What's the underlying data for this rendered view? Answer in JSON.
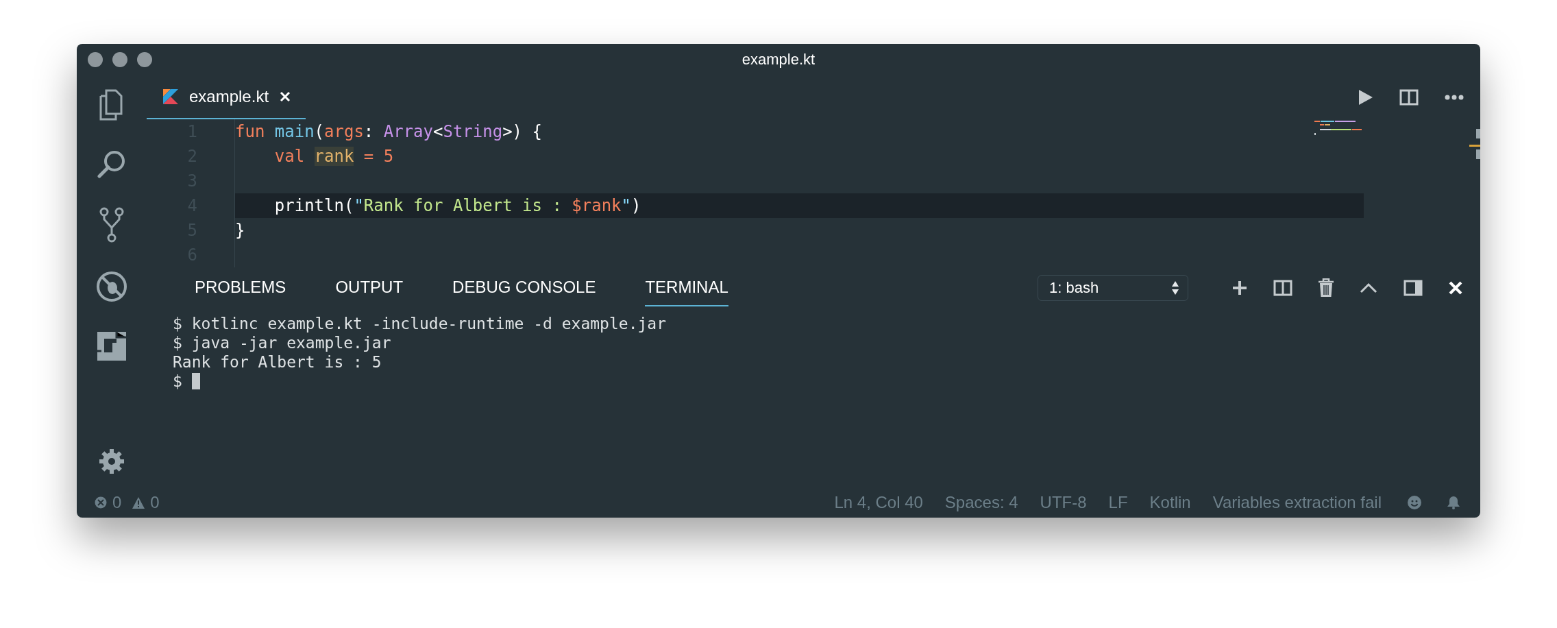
{
  "window": {
    "title": "example.kt"
  },
  "editor_tabs": [
    {
      "label": "example.kt",
      "selected": true
    }
  ],
  "code": {
    "lines": [
      {
        "number": "1",
        "current": false,
        "tokens": [
          {
            "text": "fun ",
            "kind": "keyword"
          },
          {
            "text": "main",
            "kind": "function"
          },
          {
            "text": "(",
            "kind": "plain"
          },
          {
            "text": "args",
            "kind": "keyword"
          },
          {
            "text": ": ",
            "kind": "param"
          },
          {
            "text": "Array",
            "kind": "type"
          },
          {
            "text": "<",
            "kind": "plain"
          },
          {
            "text": "String",
            "kind": "type"
          },
          {
            "text": ">) {",
            "kind": "plain"
          }
        ]
      },
      {
        "number": "2",
        "current": false,
        "tokens": [
          {
            "text": "    val ",
            "kind": "keyword"
          },
          {
            "text": "rank",
            "kind": "highlight"
          },
          {
            "text": " = 5",
            "kind": "keyword"
          }
        ]
      },
      {
        "number": "3",
        "current": false
      },
      {
        "number": "4",
        "current": true,
        "tokens": [
          {
            "text": "    println(",
            "kind": "plain"
          },
          {
            "text": "\"",
            "kind": "type2"
          },
          {
            "text": "Rank for Albert is : ",
            "kind": "string"
          },
          {
            "text": "$rank",
            "kind": "interp"
          },
          {
            "text": "\"",
            "kind": "type2"
          },
          {
            "text": ")",
            "kind": "plain"
          }
        ]
      },
      {
        "number": "5",
        "current": false,
        "tokens": [
          {
            "text": "}",
            "kind": "plain"
          }
        ]
      },
      {
        "number": "6",
        "current": false
      }
    ]
  },
  "panel": {
    "tabs": [
      {
        "label": "PROBLEMS",
        "selected": false
      },
      {
        "label": "OUTPUT",
        "selected": false
      },
      {
        "label": "DEBUG CONSOLE",
        "selected": false
      },
      {
        "label": "TERMINAL",
        "selected": true
      }
    ],
    "terminal_select": {
      "value": "1: bash"
    },
    "terminal_lines": [
      "$ kotlinc example.kt -include-runtime -d example.jar",
      "$ java -jar example.jar",
      "Rank for Albert is : 5",
      "$ "
    ]
  },
  "status_bar": {
    "errors": "0",
    "warnings": "0",
    "items": [
      "Ln 4, Col 40",
      "Spaces: 4",
      "UTF-8",
      "LF",
      "Kotlin",
      "Variables extraction fail"
    ]
  }
}
